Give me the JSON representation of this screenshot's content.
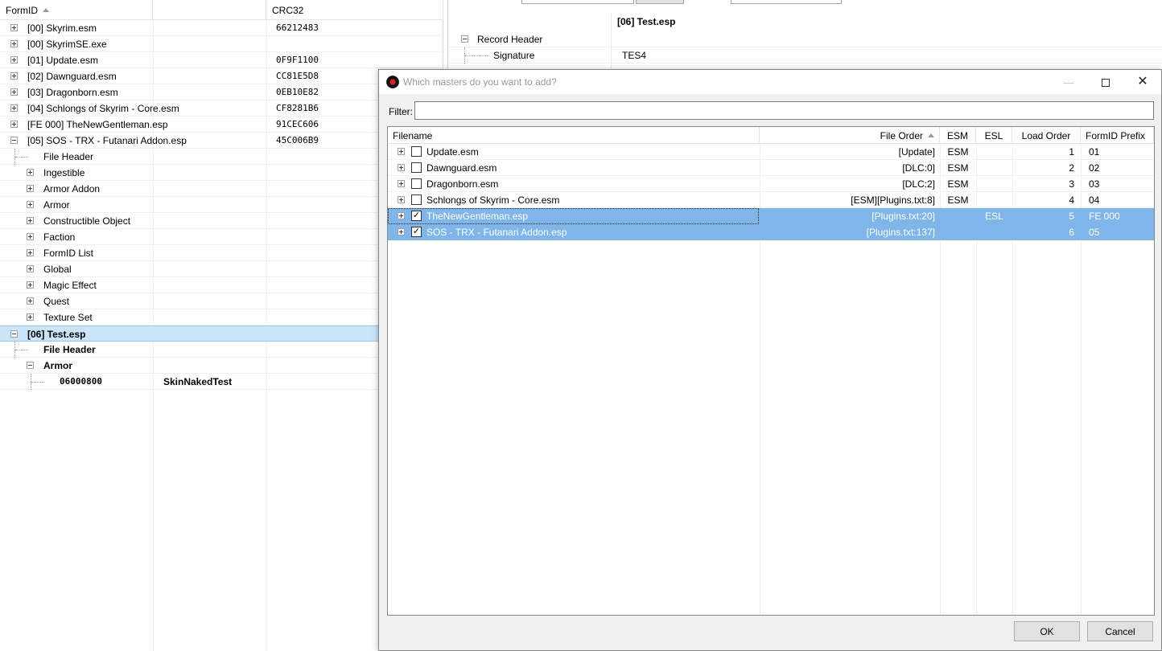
{
  "left_tree": {
    "columns": {
      "formid": "FormID",
      "crc": "CRC32"
    },
    "rows": [
      {
        "name": "[00] Skyrim.esm",
        "crc": "66212483",
        "level": 0,
        "exp": "plus"
      },
      {
        "name": "[00] SkyrimSE.exe",
        "crc": "",
        "level": 0,
        "exp": "plus"
      },
      {
        "name": "[01] Update.esm",
        "crc": "0F9F1100",
        "level": 0,
        "exp": "plus"
      },
      {
        "name": "[02] Dawnguard.esm",
        "crc": "CC81E5D8",
        "level": 0,
        "exp": "plus"
      },
      {
        "name": "[03] Dragonborn.esm",
        "crc": "0EB10E82",
        "level": 0,
        "exp": "plus"
      },
      {
        "name": "[04] Schlongs of Skyrim - Core.esm",
        "crc": "CF8281B6",
        "level": 0,
        "exp": "plus"
      },
      {
        "name": "[FE 000] TheNewGentleman.esp",
        "crc": "91CEC606",
        "level": 0,
        "exp": "plus"
      },
      {
        "name": "[05] SOS - TRX - Futanari Addon.esp",
        "crc": "45C006B9",
        "level": 0,
        "exp": "minus"
      },
      {
        "name": "File Header",
        "crc": "",
        "level": 1,
        "exp": "none"
      },
      {
        "name": "Ingestible",
        "crc": "",
        "level": 1,
        "exp": "plus"
      },
      {
        "name": "Armor Addon",
        "crc": "",
        "level": 1,
        "exp": "plus"
      },
      {
        "name": "Armor",
        "crc": "",
        "level": 1,
        "exp": "plus"
      },
      {
        "name": "Constructible Object",
        "crc": "",
        "level": 1,
        "exp": "plus"
      },
      {
        "name": "Faction",
        "crc": "",
        "level": 1,
        "exp": "plus"
      },
      {
        "name": "FormID List",
        "crc": "",
        "level": 1,
        "exp": "plus"
      },
      {
        "name": "Global",
        "crc": "",
        "level": 1,
        "exp": "plus"
      },
      {
        "name": "Magic Effect",
        "crc": "",
        "level": 1,
        "exp": "plus"
      },
      {
        "name": "Quest",
        "crc": "",
        "level": 1,
        "exp": "plus"
      },
      {
        "name": "Texture Set",
        "crc": "",
        "level": 1,
        "exp": "plus"
      },
      {
        "name": "[06] Test.esp",
        "crc": "",
        "level": 0,
        "exp": "minus",
        "bold": true,
        "selected": true
      },
      {
        "name": "File Header",
        "crc": "",
        "level": 1,
        "exp": "none",
        "bold": true
      },
      {
        "name": "Armor",
        "crc": "",
        "level": 1,
        "exp": "minus",
        "bold": true
      },
      {
        "name": "06000800",
        "crc": "",
        "level": 2,
        "exp": "none",
        "bold": true,
        "mono": true,
        "editor_id": "SkinNakedTest"
      }
    ]
  },
  "right_panel": {
    "title": "[06] Test.esp",
    "record_header": "Record Header",
    "signature_label": "Signature",
    "signature_value": "TES4"
  },
  "dialog": {
    "title": "Which masters do you want to add?",
    "filter_label": "Filter:",
    "filter_value": "",
    "columns": {
      "filename": "Filename",
      "file_order": "File Order",
      "esm": "ESM",
      "esl": "ESL",
      "load_order": "Load Order",
      "formid_prefix": "FormID Prefix"
    },
    "rows": [
      {
        "filename": "Update.esm",
        "file_order": "[Update]",
        "esm": "ESM",
        "esl": "",
        "load_order": "1",
        "prefix": "01",
        "checked": false,
        "selected": false
      },
      {
        "filename": "Dawnguard.esm",
        "file_order": "[DLC:0]",
        "esm": "ESM",
        "esl": "",
        "load_order": "2",
        "prefix": "02",
        "checked": false,
        "selected": false
      },
      {
        "filename": "Dragonborn.esm",
        "file_order": "[DLC:2]",
        "esm": "ESM",
        "esl": "",
        "load_order": "3",
        "prefix": "03",
        "checked": false,
        "selected": false
      },
      {
        "filename": "Schlongs of Skyrim - Core.esm",
        "file_order": "[ESM][Plugins.txt:8]",
        "esm": "ESM",
        "esl": "",
        "load_order": "4",
        "prefix": "04",
        "checked": false,
        "selected": false
      },
      {
        "filename": "TheNewGentleman.esp",
        "file_order": "[Plugins.txt:20]",
        "esm": "",
        "esl": "ESL",
        "load_order": "5",
        "prefix": "FE 000",
        "checked": true,
        "selected": true,
        "focus": true
      },
      {
        "filename": "SOS - TRX - Futanari Addon.esp",
        "file_order": "[Plugins.txt:137]",
        "esm": "",
        "esl": "",
        "load_order": "6",
        "prefix": "05",
        "checked": true,
        "selected": true
      }
    ],
    "ok_label": "OK",
    "cancel_label": "Cancel"
  },
  "colors": {
    "tree_selection": "#cce4f7",
    "list_selection": "#7fb5e8",
    "dialog_bg": "#f0f0f0"
  }
}
